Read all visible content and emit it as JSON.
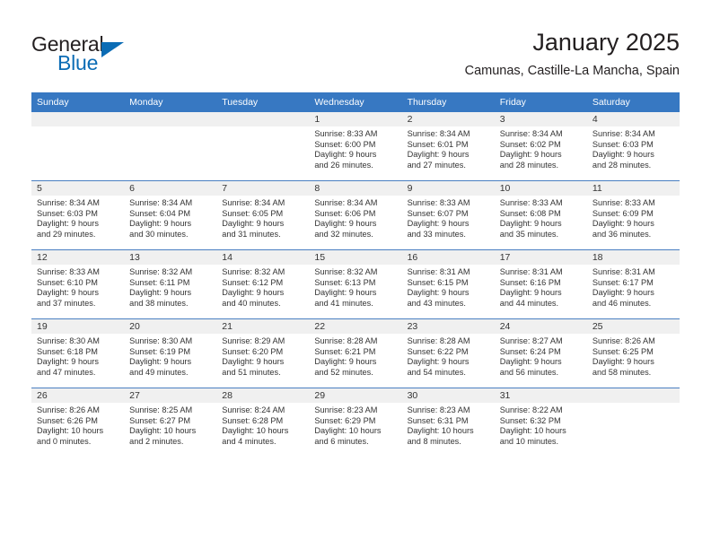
{
  "brand": {
    "name_part1": "General",
    "name_part2": "Blue",
    "triangle_icon": "triangle-icon",
    "accent_color": "#0b6cb5"
  },
  "header": {
    "title": "January 2025",
    "subtitle": "Camunas, Castille-La Mancha, Spain"
  },
  "theme": {
    "header_blue": "#3778c2",
    "row_divider": "#4a7fc1",
    "daynum_band": "#f0f0f0",
    "text": "#333333"
  },
  "calendar": {
    "weekday_headers": [
      "Sunday",
      "Monday",
      "Tuesday",
      "Wednesday",
      "Thursday",
      "Friday",
      "Saturday"
    ],
    "weeks": [
      [
        {
          "empty": true
        },
        {
          "empty": true
        },
        {
          "empty": true
        },
        {
          "day": "1",
          "sunrise": "Sunrise: 8:33 AM",
          "sunset": "Sunset: 6:00 PM",
          "daylight_line1": "Daylight: 9 hours",
          "daylight_line2": "and 26 minutes."
        },
        {
          "day": "2",
          "sunrise": "Sunrise: 8:34 AM",
          "sunset": "Sunset: 6:01 PM",
          "daylight_line1": "Daylight: 9 hours",
          "daylight_line2": "and 27 minutes."
        },
        {
          "day": "3",
          "sunrise": "Sunrise: 8:34 AM",
          "sunset": "Sunset: 6:02 PM",
          "daylight_line1": "Daylight: 9 hours",
          "daylight_line2": "and 28 minutes."
        },
        {
          "day": "4",
          "sunrise": "Sunrise: 8:34 AM",
          "sunset": "Sunset: 6:03 PM",
          "daylight_line1": "Daylight: 9 hours",
          "daylight_line2": "and 28 minutes."
        }
      ],
      [
        {
          "day": "5",
          "sunrise": "Sunrise: 8:34 AM",
          "sunset": "Sunset: 6:03 PM",
          "daylight_line1": "Daylight: 9 hours",
          "daylight_line2": "and 29 minutes."
        },
        {
          "day": "6",
          "sunrise": "Sunrise: 8:34 AM",
          "sunset": "Sunset: 6:04 PM",
          "daylight_line1": "Daylight: 9 hours",
          "daylight_line2": "and 30 minutes."
        },
        {
          "day": "7",
          "sunrise": "Sunrise: 8:34 AM",
          "sunset": "Sunset: 6:05 PM",
          "daylight_line1": "Daylight: 9 hours",
          "daylight_line2": "and 31 minutes."
        },
        {
          "day": "8",
          "sunrise": "Sunrise: 8:34 AM",
          "sunset": "Sunset: 6:06 PM",
          "daylight_line1": "Daylight: 9 hours",
          "daylight_line2": "and 32 minutes."
        },
        {
          "day": "9",
          "sunrise": "Sunrise: 8:33 AM",
          "sunset": "Sunset: 6:07 PM",
          "daylight_line1": "Daylight: 9 hours",
          "daylight_line2": "and 33 minutes."
        },
        {
          "day": "10",
          "sunrise": "Sunrise: 8:33 AM",
          "sunset": "Sunset: 6:08 PM",
          "daylight_line1": "Daylight: 9 hours",
          "daylight_line2": "and 35 minutes."
        },
        {
          "day": "11",
          "sunrise": "Sunrise: 8:33 AM",
          "sunset": "Sunset: 6:09 PM",
          "daylight_line1": "Daylight: 9 hours",
          "daylight_line2": "and 36 minutes."
        }
      ],
      [
        {
          "day": "12",
          "sunrise": "Sunrise: 8:33 AM",
          "sunset": "Sunset: 6:10 PM",
          "daylight_line1": "Daylight: 9 hours",
          "daylight_line2": "and 37 minutes."
        },
        {
          "day": "13",
          "sunrise": "Sunrise: 8:32 AM",
          "sunset": "Sunset: 6:11 PM",
          "daylight_line1": "Daylight: 9 hours",
          "daylight_line2": "and 38 minutes."
        },
        {
          "day": "14",
          "sunrise": "Sunrise: 8:32 AM",
          "sunset": "Sunset: 6:12 PM",
          "daylight_line1": "Daylight: 9 hours",
          "daylight_line2": "and 40 minutes."
        },
        {
          "day": "15",
          "sunrise": "Sunrise: 8:32 AM",
          "sunset": "Sunset: 6:13 PM",
          "daylight_line1": "Daylight: 9 hours",
          "daylight_line2": "and 41 minutes."
        },
        {
          "day": "16",
          "sunrise": "Sunrise: 8:31 AM",
          "sunset": "Sunset: 6:15 PM",
          "daylight_line1": "Daylight: 9 hours",
          "daylight_line2": "and 43 minutes."
        },
        {
          "day": "17",
          "sunrise": "Sunrise: 8:31 AM",
          "sunset": "Sunset: 6:16 PM",
          "daylight_line1": "Daylight: 9 hours",
          "daylight_line2": "and 44 minutes."
        },
        {
          "day": "18",
          "sunrise": "Sunrise: 8:31 AM",
          "sunset": "Sunset: 6:17 PM",
          "daylight_line1": "Daylight: 9 hours",
          "daylight_line2": "and 46 minutes."
        }
      ],
      [
        {
          "day": "19",
          "sunrise": "Sunrise: 8:30 AM",
          "sunset": "Sunset: 6:18 PM",
          "daylight_line1": "Daylight: 9 hours",
          "daylight_line2": "and 47 minutes."
        },
        {
          "day": "20",
          "sunrise": "Sunrise: 8:30 AM",
          "sunset": "Sunset: 6:19 PM",
          "daylight_line1": "Daylight: 9 hours",
          "daylight_line2": "and 49 minutes."
        },
        {
          "day": "21",
          "sunrise": "Sunrise: 8:29 AM",
          "sunset": "Sunset: 6:20 PM",
          "daylight_line1": "Daylight: 9 hours",
          "daylight_line2": "and 51 minutes."
        },
        {
          "day": "22",
          "sunrise": "Sunrise: 8:28 AM",
          "sunset": "Sunset: 6:21 PM",
          "daylight_line1": "Daylight: 9 hours",
          "daylight_line2": "and 52 minutes."
        },
        {
          "day": "23",
          "sunrise": "Sunrise: 8:28 AM",
          "sunset": "Sunset: 6:22 PM",
          "daylight_line1": "Daylight: 9 hours",
          "daylight_line2": "and 54 minutes."
        },
        {
          "day": "24",
          "sunrise": "Sunrise: 8:27 AM",
          "sunset": "Sunset: 6:24 PM",
          "daylight_line1": "Daylight: 9 hours",
          "daylight_line2": "and 56 minutes."
        },
        {
          "day": "25",
          "sunrise": "Sunrise: 8:26 AM",
          "sunset": "Sunset: 6:25 PM",
          "daylight_line1": "Daylight: 9 hours",
          "daylight_line2": "and 58 minutes."
        }
      ],
      [
        {
          "day": "26",
          "sunrise": "Sunrise: 8:26 AM",
          "sunset": "Sunset: 6:26 PM",
          "daylight_line1": "Daylight: 10 hours",
          "daylight_line2": "and 0 minutes."
        },
        {
          "day": "27",
          "sunrise": "Sunrise: 8:25 AM",
          "sunset": "Sunset: 6:27 PM",
          "daylight_line1": "Daylight: 10 hours",
          "daylight_line2": "and 2 minutes."
        },
        {
          "day": "28",
          "sunrise": "Sunrise: 8:24 AM",
          "sunset": "Sunset: 6:28 PM",
          "daylight_line1": "Daylight: 10 hours",
          "daylight_line2": "and 4 minutes."
        },
        {
          "day": "29",
          "sunrise": "Sunrise: 8:23 AM",
          "sunset": "Sunset: 6:29 PM",
          "daylight_line1": "Daylight: 10 hours",
          "daylight_line2": "and 6 minutes."
        },
        {
          "day": "30",
          "sunrise": "Sunrise: 8:23 AM",
          "sunset": "Sunset: 6:31 PM",
          "daylight_line1": "Daylight: 10 hours",
          "daylight_line2": "and 8 minutes."
        },
        {
          "day": "31",
          "sunrise": "Sunrise: 8:22 AM",
          "sunset": "Sunset: 6:32 PM",
          "daylight_line1": "Daylight: 10 hours",
          "daylight_line2": "and 10 minutes."
        },
        {
          "empty": true
        }
      ]
    ]
  }
}
